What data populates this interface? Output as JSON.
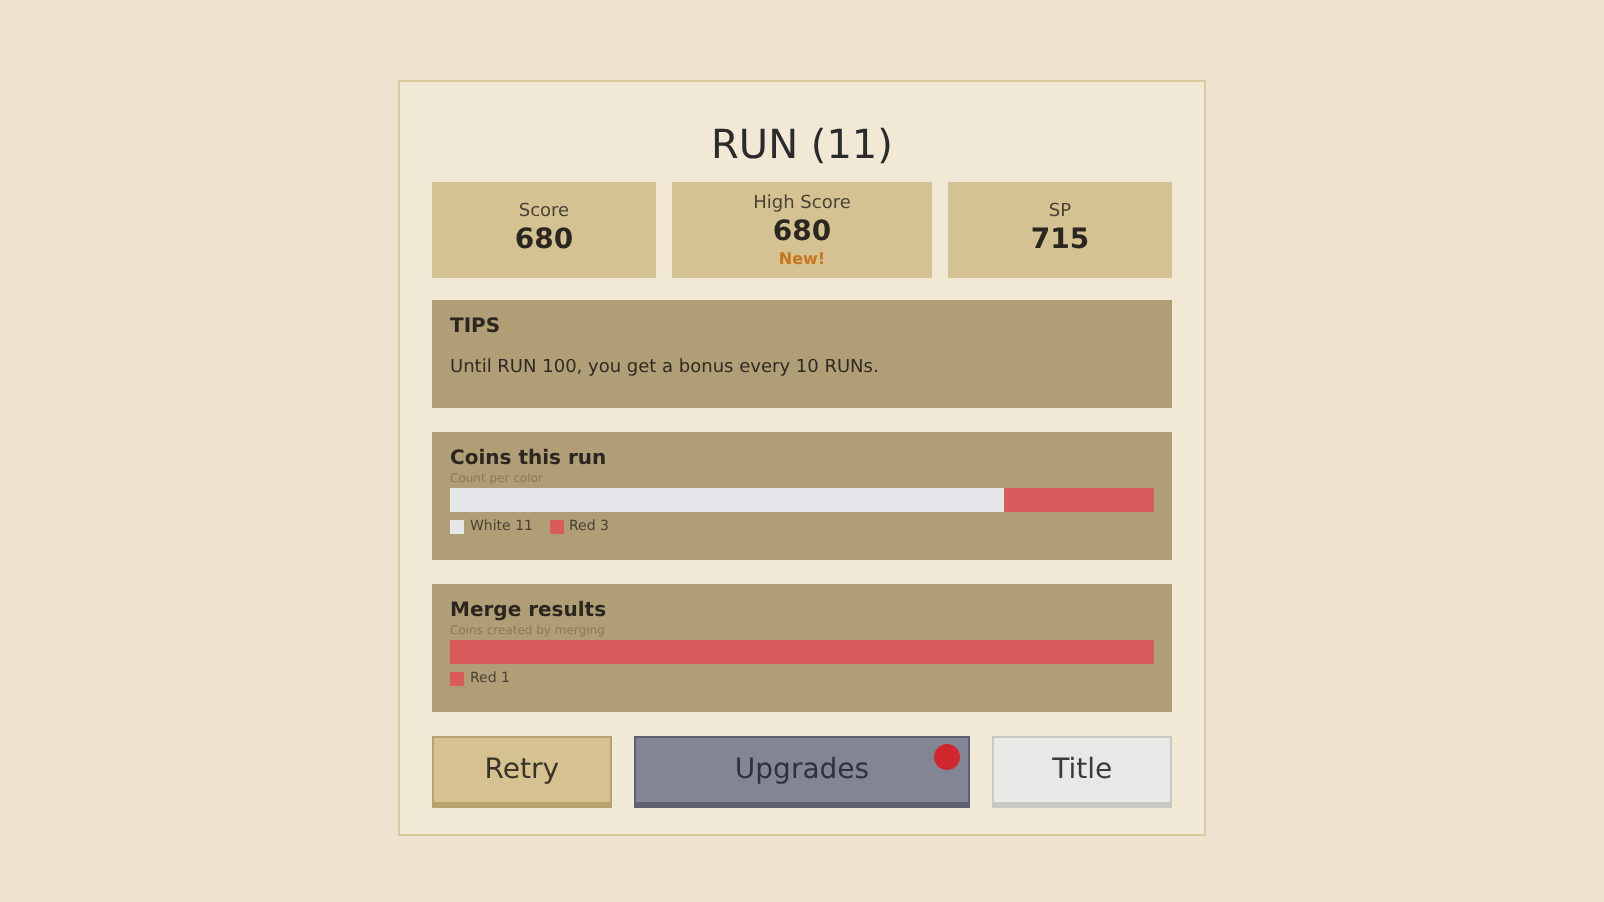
{
  "title": "RUN (11)",
  "stats": [
    {
      "label": "Score",
      "value": "680"
    },
    {
      "label": "High Score",
      "value": "680",
      "note": "New!"
    },
    {
      "label": "SP",
      "value": "715"
    }
  ],
  "tips": {
    "title": "TIPS",
    "text": "Until RUN 100, you get a bonus every 10 RUNs."
  },
  "charts": [
    {
      "title": "Coins this run",
      "subtitle": "Count per color",
      "level": 0.786,
      "segments": [
        {
          "label": "White 11",
          "color": "#e5e7eb"
        },
        {
          "label": "Red 3",
          "color": "#d95b5b"
        }
      ]
    },
    {
      "title": "Merge results",
      "subtitle": "Coins created by merging",
      "segments": [
        {
          "label": "Red 1",
          "color": "#d95b5b"
        }
      ]
    }
  ],
  "buttons": [
    {
      "label": "Retry",
      "kind": "gold",
      "badge": false
    },
    {
      "label": "Upgrades",
      "kind": "slate",
      "badge": true
    },
    {
      "label": "Title",
      "kind": "light",
      "badge": false
    }
  ]
}
